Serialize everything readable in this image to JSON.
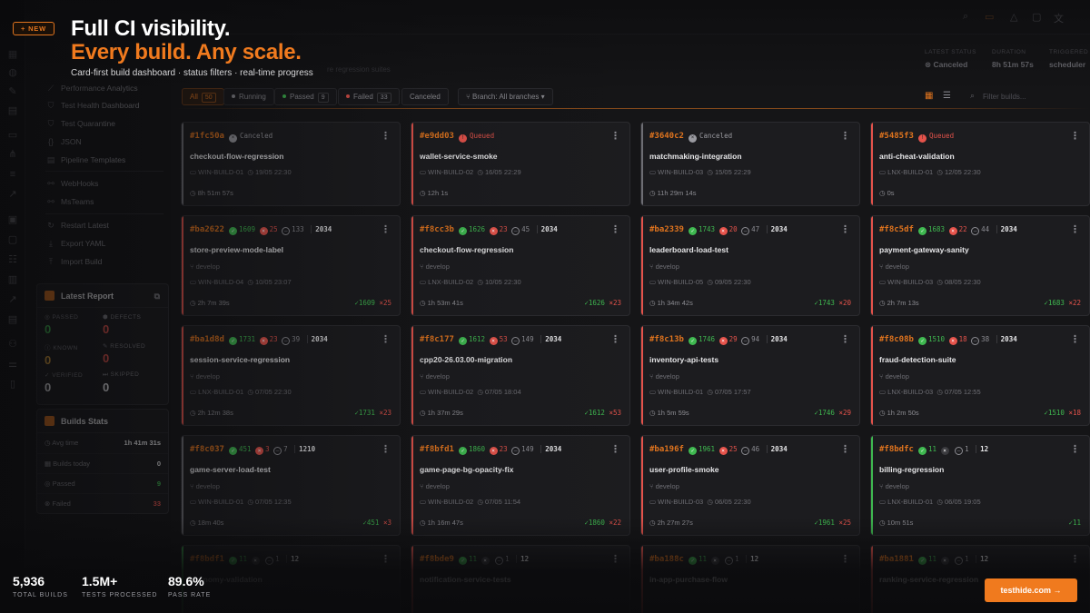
{
  "colors": {
    "accent": "#f07a1e",
    "passed": "#3fb950",
    "failed": "#e5534b",
    "queued": "#e5534b",
    "canceled": "#8c8c92"
  },
  "sidebar": {
    "items": [
      {
        "label": "Performance Analytics",
        "icon": "chart-line-icon"
      },
      {
        "label": "Test Health Dashboard",
        "icon": "shield-icon"
      },
      {
        "label": "Test Quarantine",
        "icon": "shield-icon"
      },
      {
        "label": "JSON",
        "icon": "braces-icon"
      },
      {
        "label": "Pipeline Templates",
        "icon": "document-icon"
      },
      {
        "label": "WebHooks",
        "icon": "webhook-icon"
      },
      {
        "label": "MsTeams",
        "icon": "teams-icon"
      },
      {
        "label": "Restart Latest",
        "icon": "restart-icon"
      },
      {
        "label": "Export YAML",
        "icon": "download-icon"
      },
      {
        "label": "Import Build",
        "icon": "upload-icon"
      }
    ],
    "latest_report": {
      "title": "Latest Report",
      "cells": [
        {
          "label": "PASSED",
          "value": "0",
          "color": "#3fb950"
        },
        {
          "label": "DEFECTS",
          "value": "0",
          "color": "#e5534b"
        },
        {
          "label": "KNOWN",
          "value": "0",
          "color": "#e0a23a"
        },
        {
          "label": "RESOLVED",
          "value": "0",
          "color": "#e5534b"
        },
        {
          "label": "VERIFIED",
          "value": "0",
          "color": "#e6e6e8"
        },
        {
          "label": "SKIPPED",
          "value": "0",
          "color": "#e6e6e8"
        }
      ]
    },
    "builds_stats": {
      "title": "Builds Stats",
      "rows": [
        {
          "label": "Avg time",
          "value": "1h 41m 31s",
          "color": "#e6e6e8"
        },
        {
          "label": "Builds today",
          "value": "0",
          "color": "#e6e6e8"
        },
        {
          "label": "Passed",
          "value": "9",
          "color": "#3fb950"
        },
        {
          "label": "Failed",
          "value": "33",
          "color": "#e5534b"
        }
      ]
    }
  },
  "header": {
    "dim_subtitle": "re regression suites",
    "status": {
      "latest_status_label": "LATEST STATUS",
      "latest_status_value": "Canceled",
      "duration_label": "DURATION",
      "duration_value": "8h 51m 57s",
      "trigger_label": "TRIGGERED",
      "trigger_value": "scheduler"
    }
  },
  "filters": {
    "all_label": "All",
    "all_count": "50",
    "running_label": "Running",
    "passed_label": "Passed",
    "passed_count": "9",
    "failed_label": "Failed",
    "failed_count": "33",
    "canceled_label": "Canceled",
    "branch_label": "Branch: All branches",
    "search_placeholder": "Filter builds..."
  },
  "cards": [
    {
      "hash": "#1fc50a",
      "status": "Canceled",
      "name": "checkout-flow-regression",
      "host": "WIN-BUILD-01",
      "date": "19/05 22:30",
      "duration": "8h 51m 57s",
      "tone": "canceled"
    },
    {
      "hash": "#e9dd03",
      "status": "Queued",
      "name": "wallet-service-smoke",
      "host": "WIN-BUILD-02",
      "date": "16/05 22:29",
      "duration": "12h 1s",
      "tone": "queued"
    },
    {
      "hash": "#3640c2",
      "status": "Canceled",
      "name": "matchmaking-integration",
      "host": "WIN-BUILD-03",
      "date": "15/05 22:29",
      "duration": "11h 29m 14s",
      "tone": "canceled"
    },
    {
      "hash": "#5485f3",
      "status": "Queued",
      "name": "anti-cheat-validation",
      "host": "LNX-BUILD-01",
      "date": "12/05 22:30",
      "duration": "0s",
      "tone": "queued"
    },
    {
      "hash": "#ba2622",
      "p": "1609",
      "f": "25",
      "s": "133",
      "t": "2034",
      "name": "store-preview-mode-label",
      "branch": "develop",
      "host": "WIN-BUILD-04",
      "date": "10/05 23:07",
      "duration": "2h 7m 39s",
      "rp": "✓1609",
      "rf": "×25",
      "tone": "failed"
    },
    {
      "hash": "#f8cc3b",
      "p": "1626",
      "f": "23",
      "s": "45",
      "t": "2034",
      "name": "checkout-flow-regression",
      "branch": "develop",
      "host": "LNX-BUILD-02",
      "date": "10/05 22:30",
      "duration": "1h 53m 41s",
      "rp": "✓1626",
      "rf": "×23",
      "tone": "failed"
    },
    {
      "hash": "#ba2339",
      "p": "1743",
      "f": "20",
      "s": "47",
      "t": "2034",
      "name": "leaderboard-load-test",
      "branch": "develop",
      "host": "WIN-BUILD-05",
      "date": "09/05 22:30",
      "duration": "1h 34m 42s",
      "rp": "✓1743",
      "rf": "×20",
      "tone": "failed"
    },
    {
      "hash": "#f8c5df",
      "p": "1683",
      "f": "22",
      "s": "44",
      "t": "2034",
      "name": "payment-gateway-sanity",
      "branch": "develop",
      "host": "WIN-BUILD-03",
      "date": "08/05 22:30",
      "duration": "2h 7m 13s",
      "rp": "✓1683",
      "rf": "×22",
      "tone": "failed"
    },
    {
      "hash": "#ba1d8d",
      "p": "1731",
      "f": "23",
      "s": "39",
      "t": "2034",
      "name": "session-service-regression",
      "branch": "develop",
      "host": "LNX-BUILD-01",
      "date": "07/05 22:30",
      "duration": "2h 12m 38s",
      "rp": "✓1731",
      "rf": "×23",
      "tone": "failed"
    },
    {
      "hash": "#f8c177",
      "p": "1612",
      "f": "53",
      "s": "149",
      "t": "2034",
      "name": "cpp20-26.03.00-migration",
      "branch": "develop",
      "host": "WIN-BUILD-02",
      "date": "07/05 18:04",
      "duration": "1h 37m 29s",
      "rp": "✓1612",
      "rf": "×53",
      "tone": "failed"
    },
    {
      "hash": "#f8c13b",
      "p": "1746",
      "f": "29",
      "s": "94",
      "t": "2034",
      "name": "inventory-api-tests",
      "branch": "develop",
      "host": "WIN-BUILD-01",
      "date": "07/05 17:57",
      "duration": "1h 5m 59s",
      "rp": "✓1746",
      "rf": "×29",
      "tone": "failed"
    },
    {
      "hash": "#f8c08b",
      "p": "1510",
      "f": "18",
      "s": "38",
      "t": "2034",
      "name": "fraud-detection-suite",
      "branch": "develop",
      "host": "LNX-BUILD-03",
      "date": "07/05 12:55",
      "duration": "1h 2m 50s",
      "rp": "✓1510",
      "rf": "×18",
      "tone": "failed"
    },
    {
      "hash": "#f8c037",
      "p": "451",
      "f": "3",
      "s": "7",
      "t": "1210",
      "name": "game-server-load-test",
      "branch": "develop",
      "host": "WIN-BUILD-01",
      "date": "07/05 12:35",
      "duration": "18m 40s",
      "rp": "✓451",
      "rf": "×3",
      "tone": "canceled"
    },
    {
      "hash": "#f8bfd1",
      "p": "1860",
      "f": "23",
      "s": "149",
      "t": "2034",
      "name": "game-page-bg-opacity-fix",
      "branch": "develop",
      "host": "WIN-BUILD-02",
      "date": "07/05 11:54",
      "duration": "1h 16m 47s",
      "rp": "✓1860",
      "rf": "×22",
      "tone": "failed"
    },
    {
      "hash": "#ba196f",
      "p": "1961",
      "f": "25",
      "s": "46",
      "t": "2034",
      "name": "user-profile-smoke",
      "branch": "develop",
      "host": "WIN-BUILD-03",
      "date": "06/05 22:30",
      "duration": "2h 27m 27s",
      "rp": "✓1961",
      "rf": "×25",
      "tone": "failed"
    },
    {
      "hash": "#f8bdfc",
      "p": "11",
      "f": "",
      "s": "1",
      "t": "12",
      "name": "billing-regression",
      "branch": "develop",
      "host": "LNX-BUILD-01",
      "date": "06/05 19:05",
      "duration": "10m 51s",
      "rp": "✓11",
      "rf": "",
      "tone": "passed"
    },
    {
      "hash": "#f8bdf1",
      "p": "11",
      "s": "1",
      "t": "12",
      "name": "economy-validation",
      "tone": "passed"
    },
    {
      "hash": "#f8bde9",
      "p": "11",
      "s": "1",
      "t": "12",
      "name": "notification-service-tests",
      "tone": "failed"
    },
    {
      "hash": "#ba188c",
      "p": "11",
      "s": "1",
      "t": "12",
      "name": "in-app-purchase-flow",
      "tone": "failed"
    },
    {
      "hash": "#ba1881",
      "p": "11",
      "s": "1",
      "t": "12",
      "name": "ranking-service-regression",
      "tone": "failed"
    }
  ],
  "promo": {
    "new_badge": "+ NEW",
    "headline_1": "Full CI visibility.",
    "headline_2": "Every build. Any scale.",
    "tagline": "Card-first build dashboard · status filters · real-time progress",
    "kpis": [
      {
        "value": "5,936",
        "label": "TOTAL BUILDS"
      },
      {
        "value": "1.5M+",
        "label": "TESTS PROCESSED"
      },
      {
        "value": "89.6%",
        "label": "PASS RATE"
      }
    ],
    "cta": "testhide.com →"
  }
}
